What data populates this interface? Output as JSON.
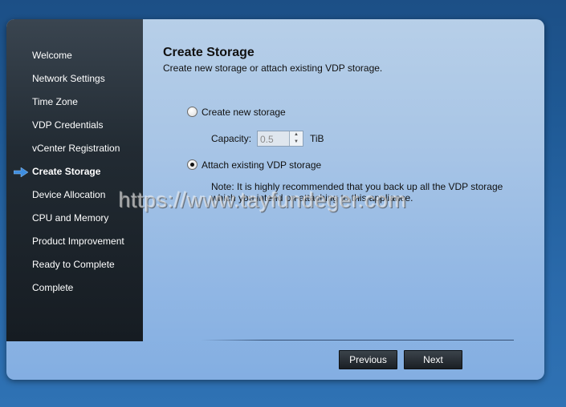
{
  "sidebar": {
    "items": [
      {
        "label": "Welcome"
      },
      {
        "label": "Network Settings"
      },
      {
        "label": "Time Zone"
      },
      {
        "label": "VDP Credentials"
      },
      {
        "label": "vCenter Registration"
      },
      {
        "label": "Create Storage"
      },
      {
        "label": "Device Allocation"
      },
      {
        "label": "CPU and Memory"
      },
      {
        "label": "Product Improvement"
      },
      {
        "label": "Ready to Complete"
      },
      {
        "label": "Complete"
      }
    ],
    "active_index": 5
  },
  "page": {
    "title": "Create Storage",
    "subtitle": "Create new storage or attach existing VDP storage."
  },
  "options": {
    "create_new_label": "Create new storage",
    "create_new_selected": false,
    "capacity_label": "Capacity:",
    "capacity_value": "0.5",
    "capacity_unit": "TiB",
    "attach_existing_label": "Attach existing VDP storage",
    "attach_existing_selected": true,
    "note": "Note:  It is highly recommended that you back up all the VDP storage which you intend on attaching to this appliance."
  },
  "watermark": "https://www.tayfundeger.com",
  "buttons": {
    "previous": "Previous",
    "next": "Next"
  }
}
